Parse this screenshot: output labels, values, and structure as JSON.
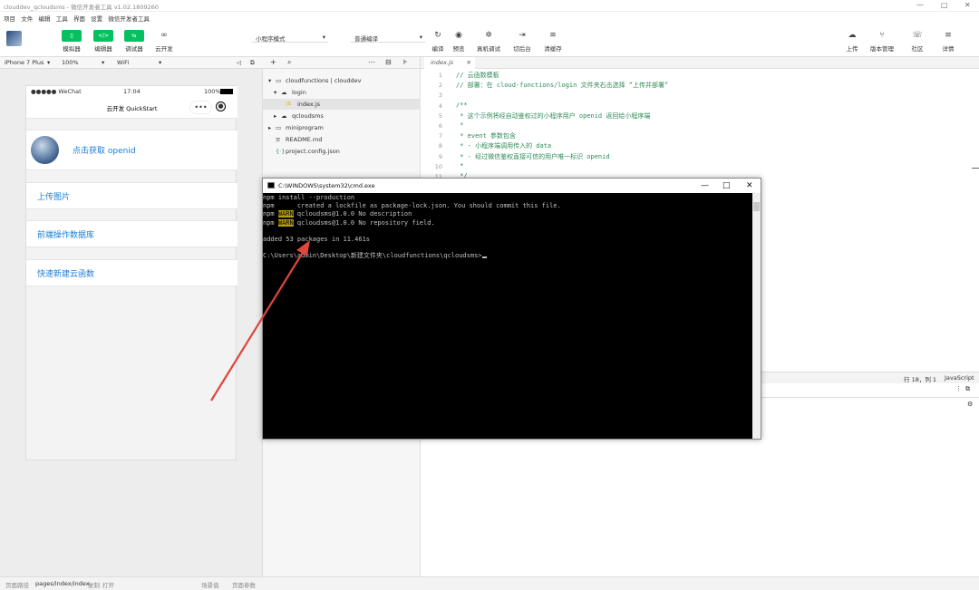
{
  "window": {
    "title": "clouddev_qcloudsms - 微信开发者工具 v1.02.1809260"
  },
  "menu": [
    "项目",
    "文件",
    "编辑",
    "工具",
    "界面",
    "设置",
    "微信开发者工具"
  ],
  "toolbar": {
    "simulator": "模拟器",
    "editor": "编辑器",
    "debugger": "调试器",
    "cloud": "云开发",
    "mode": "小程序模式",
    "compile_mode": "普通编译",
    "compile": "编译",
    "preview": "预览",
    "remote_debug": "真机调试",
    "switch_bg": "切后台",
    "clear_cache": "清缓存",
    "upload": "上传",
    "version": "版本管理",
    "community": "社区",
    "details": "详情"
  },
  "simbar": {
    "device": "iPhone 7 Plus",
    "zoom": "100%",
    "network": "WiFi"
  },
  "phone": {
    "carrier": "●●●●● WeChat",
    "time": "17:04",
    "battery": "100%",
    "title": "云开发 QuickStart",
    "cells": [
      "点击获取 openid",
      "上传图片",
      "前端操作数据库",
      "快速新建云函数"
    ]
  },
  "tree": {
    "rows": [
      {
        "label": "cloudfunctions | clouddev",
        "arrow": "▾",
        "icon": "cloud-folder"
      },
      {
        "label": "login",
        "arrow": "▾",
        "icon": "cloud"
      },
      {
        "label": "index.js",
        "arrow": "",
        "icon": "js"
      },
      {
        "label": "qcloudsms",
        "arrow": "▸",
        "icon": "cloud"
      },
      {
        "label": "miniprogram",
        "arrow": "▸",
        "icon": "folder"
      },
      {
        "label": "README.md",
        "arrow": "",
        "icon": "file"
      },
      {
        "label": "project.config.json",
        "arrow": "",
        "icon": "json"
      }
    ]
  },
  "editor": {
    "tab": "index.js",
    "lines": [
      {
        "n": "1",
        "t": "// 云函数模板"
      },
      {
        "n": "2",
        "t": "// 部署：在 cloud-functions/login 文件夹右击选择 “上传并部署”"
      },
      {
        "n": "3",
        "t": ""
      },
      {
        "n": "4",
        "t": "/**"
      },
      {
        "n": "5",
        "t": " * 这个示例将经自动鉴权过的小程序用户 openid 返回给小程序端"
      },
      {
        "n": "6",
        "t": " *"
      },
      {
        "n": "7",
        "t": " * event 参数包含"
      },
      {
        "n": "8",
        "t": " * - 小程序端调用传入的 data"
      },
      {
        "n": "9",
        "t": " * - 经过微信鉴权直接可信的用户唯一标识 openid"
      },
      {
        "n": "10",
        "t": " *"
      },
      {
        "n": "11",
        "t": " */"
      }
    ],
    "status_pos": "行 18，列 1",
    "status_lang": "JavaScript"
  },
  "cmd": {
    "title": "C:\\WINDOWS\\system32\\cmd.exe",
    "lines": [
      {
        "pre": "npm install --production",
        "warn": "",
        "post": ""
      },
      {
        "pre": "npm ",
        "warn": "",
        "post": "     created a lockfile as package-lock.json. You should commit this file."
      },
      {
        "pre": "npm ",
        "warn": "WARN",
        "post": " qcloudsms@1.0.0 No description"
      },
      {
        "pre": "npm ",
        "warn": "WARN",
        "post": " qcloudsms@1.0.0 No repository field."
      },
      {
        "pre": "",
        "warn": "",
        "post": ""
      },
      {
        "pre": "added 53 packages in 11.461s",
        "warn": "",
        "post": ""
      },
      {
        "pre": "",
        "warn": "",
        "post": ""
      },
      {
        "pre": "C:\\Users\\admin\\Desktop\\新建文件夹\\cloudfunctions\\qcloudsms>",
        "warn": "",
        "post": ""
      }
    ]
  },
  "bottom": {
    "path_label": "页面路径",
    "path": "pages/index/index",
    "copy": "复制",
    "open": "打开",
    "scene": "场景值",
    "params": "页面参数"
  },
  "colors": {
    "green": "#07c160",
    "link": "#1a7cd3",
    "arrow": "#e0463c"
  }
}
